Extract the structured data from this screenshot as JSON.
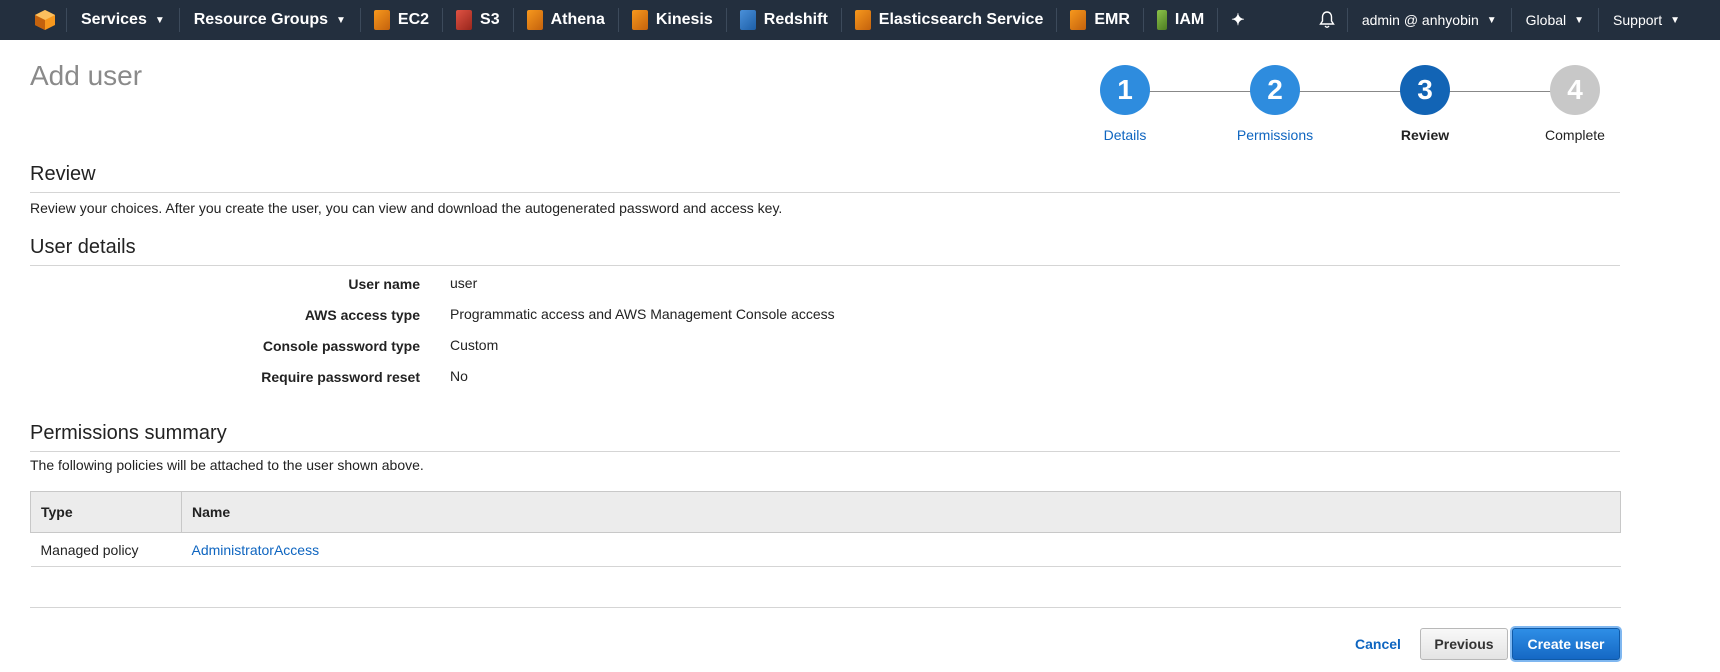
{
  "nav": {
    "services": "Services",
    "resource_groups": "Resource Groups",
    "shortcuts": [
      {
        "label": "EC2",
        "icon": "ec2-icon",
        "color": "orange"
      },
      {
        "label": "S3",
        "icon": "s3-icon",
        "color": "red"
      },
      {
        "label": "Athena",
        "icon": "athena-icon",
        "color": "orange"
      },
      {
        "label": "Kinesis",
        "icon": "kinesis-icon",
        "color": "orange"
      },
      {
        "label": "Redshift",
        "icon": "redshift-icon",
        "color": "blue"
      },
      {
        "label": "Elasticsearch Service",
        "icon": "elasticsearch-icon",
        "color": "orange"
      },
      {
        "label": "EMR",
        "icon": "emr-icon",
        "color": "orange"
      },
      {
        "label": "IAM",
        "icon": "iam-icon",
        "color": "green"
      }
    ],
    "account": "admin @ anhyobin",
    "region": "Global",
    "support": "Support"
  },
  "page": {
    "title": "Add user"
  },
  "wizard": {
    "steps": [
      {
        "num": "1",
        "label": "Details",
        "state": "done"
      },
      {
        "num": "2",
        "label": "Permissions",
        "state": "done"
      },
      {
        "num": "3",
        "label": "Review",
        "state": "current"
      },
      {
        "num": "4",
        "label": "Complete",
        "state": "pending"
      }
    ]
  },
  "review": {
    "heading": "Review",
    "description": "Review your choices. After you create the user, you can view and download the autogenerated password and access key."
  },
  "user_details": {
    "heading": "User details",
    "rows": [
      {
        "label": "User name",
        "value": "user"
      },
      {
        "label": "AWS access type",
        "value": "Programmatic access and AWS Management Console access"
      },
      {
        "label": "Console password type",
        "value": "Custom"
      },
      {
        "label": "Require password reset",
        "value": "No"
      }
    ]
  },
  "permissions": {
    "heading": "Permissions summary",
    "description": "The following policies will be attached to the user shown above.",
    "columns": [
      "Type",
      "Name"
    ],
    "rows": [
      {
        "type": "Managed policy",
        "name": "AdministratorAccess"
      }
    ]
  },
  "actions": {
    "cancel": "Cancel",
    "previous": "Previous",
    "create": "Create user"
  },
  "colors": {
    "nav_bg": "#232f3e",
    "accent": "#1264b5",
    "link": "#0e65c0"
  }
}
